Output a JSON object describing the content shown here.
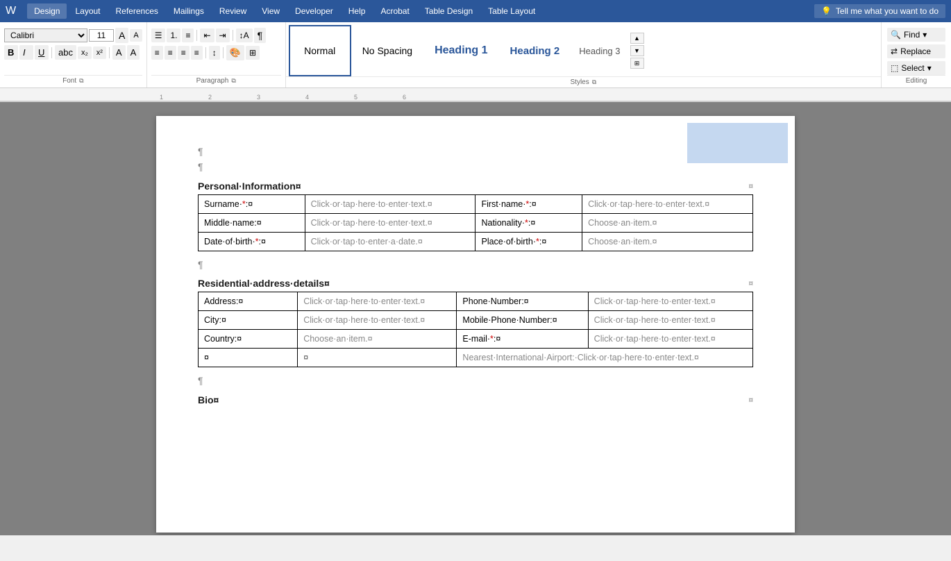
{
  "titlebar": {
    "tabs": [
      {
        "id": "design",
        "label": "Design"
      },
      {
        "id": "layout",
        "label": "Layout"
      },
      {
        "id": "references",
        "label": "References"
      },
      {
        "id": "mailings",
        "label": "Mailings"
      },
      {
        "id": "review",
        "label": "Review"
      },
      {
        "id": "view",
        "label": "View"
      },
      {
        "id": "developer",
        "label": "Developer"
      },
      {
        "id": "help",
        "label": "Help"
      },
      {
        "id": "acrobat",
        "label": "Acrobat"
      },
      {
        "id": "table-design",
        "label": "Table Design"
      },
      {
        "id": "table-layout",
        "label": "Table Layout"
      }
    ],
    "tell_me": "Tell me what you want to do",
    "tell_me_icon": "💡"
  },
  "ribbon": {
    "styles": {
      "normal": "Normal",
      "no_spacing": "No Spacing",
      "heading1": "Heading 1",
      "heading2": "Heading 2",
      "heading3": "Heading 3"
    },
    "editing": {
      "label": "Editing",
      "find": "Find",
      "replace": "Replace",
      "select": "Select"
    },
    "paragraph_label": "Paragraph",
    "styles_label": "Styles"
  },
  "document": {
    "highlight_box": true,
    "paragraphs": [
      "¶",
      "¶"
    ],
    "sections": [
      {
        "id": "personal",
        "title": "Personal·Information¤",
        "rows": [
          {
            "cells": [
              {
                "label": "Surname·*:¤",
                "required": true,
                "value": "Click·or·tap·here·to·enter·text.¤",
                "type": "text"
              },
              {
                "label": "First·name·*:¤",
                "required": true,
                "value": "Click·or·tap·here·to·enter·text.¤",
                "type": "text"
              }
            ]
          },
          {
            "cells": [
              {
                "label": "Middle·name:¤",
                "required": false,
                "value": "Click·or·tap·here·to·enter·text.¤",
                "type": "text"
              },
              {
                "label": "Nationality·*:¤",
                "required": true,
                "value": "Choose·an·item.¤",
                "type": "dropdown"
              }
            ]
          },
          {
            "cells": [
              {
                "label": "Date·of·birth·*:¤",
                "required": true,
                "value": "Click·or·tap·to·enter·a·date.¤",
                "type": "date"
              },
              {
                "label": "Place·of·birth·*:¤",
                "required": true,
                "value": "Choose·an·item.¤",
                "type": "dropdown"
              }
            ]
          }
        ]
      },
      {
        "id": "residential",
        "title": "Residential·address·details¤",
        "rows": [
          {
            "cells": [
              {
                "label": "Address:¤",
                "required": false,
                "value": "Click·or·tap·here·to·enter·text.¤",
                "type": "text"
              },
              {
                "label": "Phone·Number:¤",
                "required": false,
                "value": "Click·or·tap·here·to·enter·text.¤",
                "type": "text"
              }
            ]
          },
          {
            "cells": [
              {
                "label": "City:¤",
                "required": false,
                "value": "Click·or·tap·here·to·enter·text.¤",
                "type": "text"
              },
              {
                "label": "Mobile·Phone·Number:¤",
                "required": false,
                "value": "Click·or·tap·here·to·enter·text.¤",
                "type": "text"
              }
            ]
          },
          {
            "cells": [
              {
                "label": "Country:¤",
                "required": false,
                "value": "Choose·an·item.¤",
                "type": "dropdown"
              },
              {
                "label": "E-mail·*:¤",
                "required": true,
                "value": "Click·or·tap·here·to·enter·text.¤",
                "type": "text"
              }
            ]
          },
          {
            "cells": [
              {
                "label": "¤",
                "required": false,
                "value": "¤",
                "type": "empty"
              },
              {
                "label": "Nearest·International·Airport:·Click·or·tap·here·to·enter·text.¤",
                "required": false,
                "value": "",
                "type": "combined"
              }
            ]
          }
        ]
      }
    ],
    "bio": {
      "title": "Bio¤"
    }
  },
  "colors": {
    "accent_blue": "#2b579a",
    "heading_blue": "#2b579a",
    "required_red": "#c00000",
    "highlight_blue": "#c5d8f0"
  }
}
